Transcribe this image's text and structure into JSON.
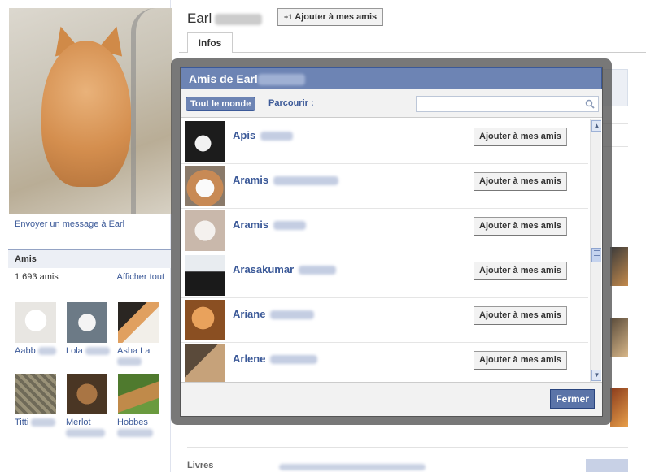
{
  "profile": {
    "first_name": "Earl",
    "send_message": "Envoyer un message à Earl",
    "add_friend": "Ajouter à mes amis",
    "tab_infos": "Infos",
    "livres_label": "Livres"
  },
  "friends_box": {
    "title": "Amis",
    "count": "1 693 amis",
    "show_all": "Afficher tout",
    "friends": [
      {
        "name": "Aabb"
      },
      {
        "name": "Lola"
      },
      {
        "name": "Asha La"
      },
      {
        "name": "Titti"
      },
      {
        "name": "Merlot"
      },
      {
        "name": "Hobbes"
      }
    ]
  },
  "dialog": {
    "title": "Amis de Earl",
    "filter_all": "Tout le monde",
    "browse_label": "Parcourir :",
    "search_value": "",
    "add_label": "Ajouter à mes amis",
    "close_label": "Fermer",
    "rows": [
      {
        "first": "Apis"
      },
      {
        "first": "Aramis"
      },
      {
        "first": "Aramis"
      },
      {
        "first": "Arasakumar"
      },
      {
        "first": "Ariane"
      },
      {
        "first": "Arlene"
      }
    ]
  },
  "colors": {
    "brand_blue": "#3b5998",
    "title_bar": "#6d84b4",
    "overlay": "#525252"
  },
  "icons": {
    "search": "search-icon",
    "scroll_up": "scroll-up-icon",
    "scroll_down": "scroll-down-icon"
  }
}
